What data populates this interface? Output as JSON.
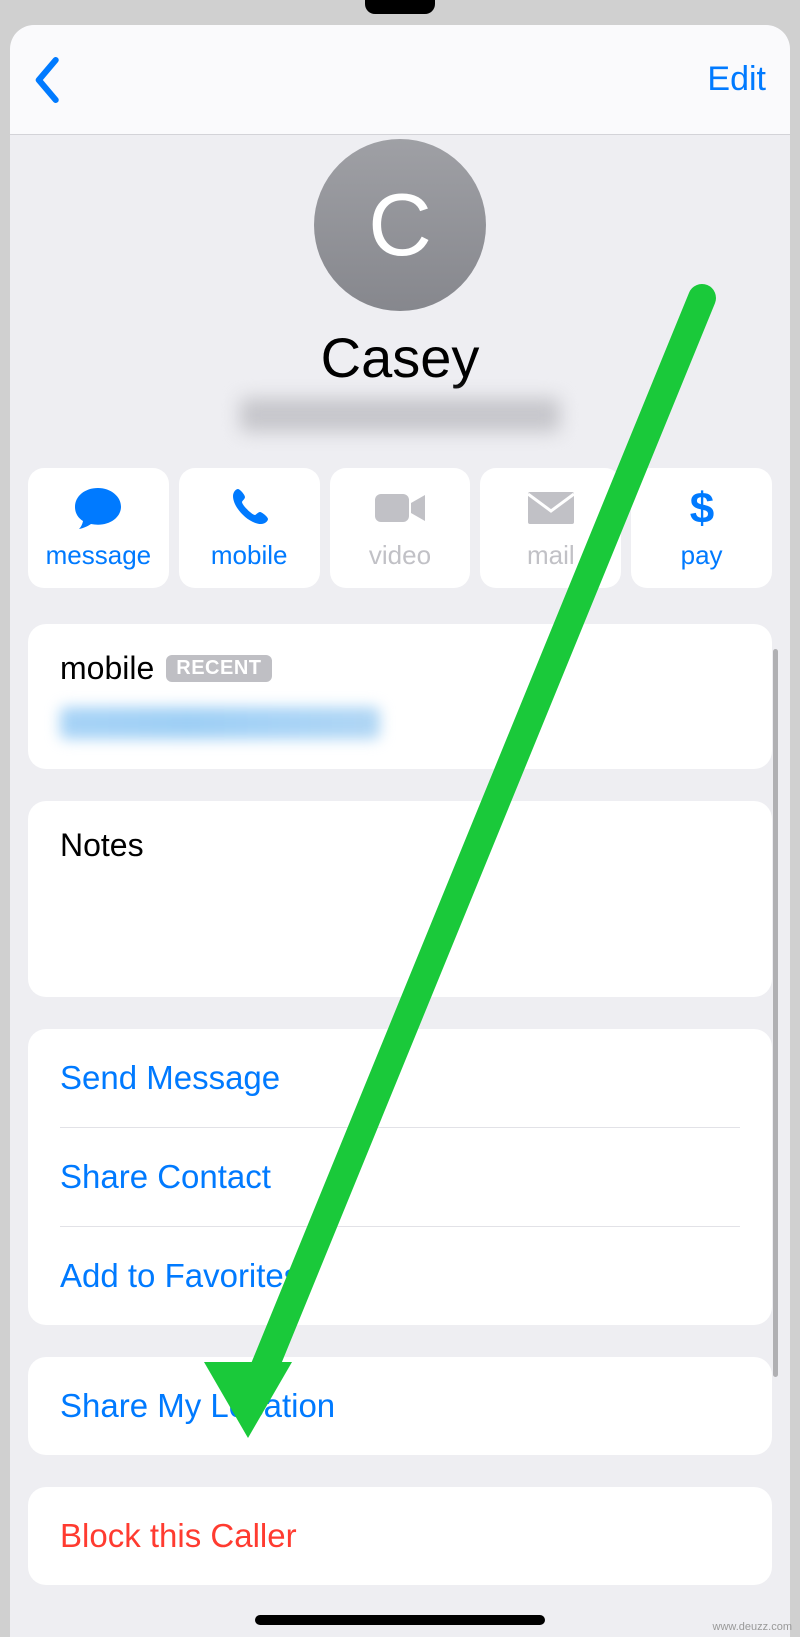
{
  "nav": {
    "edit_label": "Edit"
  },
  "contact": {
    "avatar_initial": "C",
    "name": "Casey"
  },
  "actions": {
    "message": "message",
    "mobile": "mobile",
    "video": "video",
    "mail": "mail",
    "pay": "pay"
  },
  "phone": {
    "label": "mobile",
    "recent_badge": "RECENT"
  },
  "notes": {
    "label": "Notes"
  },
  "links": {
    "send_message": "Send Message",
    "share_contact": "Share Contact",
    "add_favorites": "Add to Favorites",
    "share_location": "Share My Location",
    "block_caller": "Block this Caller"
  },
  "watermark": "www.deuzz.com",
  "colors": {
    "ios_blue": "#007aff",
    "ios_red": "#ff3b30",
    "annotation_green": "#2ecc40"
  }
}
